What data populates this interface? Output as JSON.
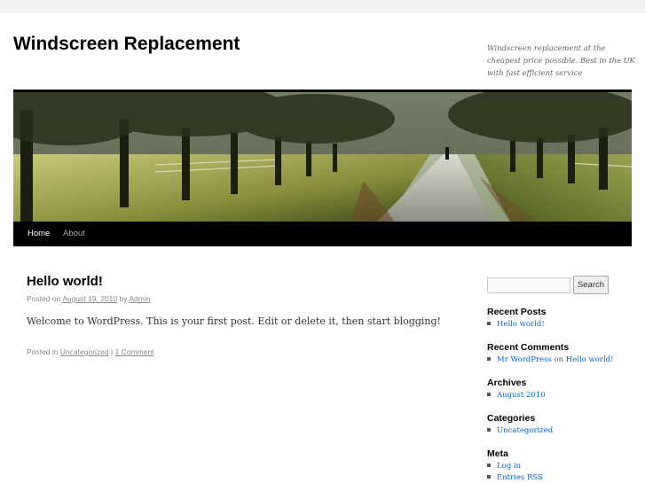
{
  "header": {
    "site_title": "Windscreen Replacement",
    "site_description": "Windscreen replacement at the cheapest price possible. Best in the UK with fast efficient service"
  },
  "nav": {
    "items": [
      {
        "label": "Home",
        "current": true
      },
      {
        "label": "About",
        "current": false
      }
    ]
  },
  "post": {
    "title": "Hello world!",
    "posted_on_prefix": "Posted on",
    "date": "August 19, 2010",
    "by": "by",
    "author": "Admin",
    "content": "Welcome to WordPress. This is your first post. Edit or delete it, then start blogging!",
    "posted_in_prefix": "Posted in",
    "category": "Uncategorized",
    "separator": "|",
    "comments": "1 Comment"
  },
  "sidebar": {
    "search_button": "Search",
    "search_value": "",
    "recent_posts_title": "Recent Posts",
    "recent_posts": [
      "Hello world!"
    ],
    "recent_comments_title": "Recent Comments",
    "recent_comment": {
      "author": "Mr WordPress",
      "on": "on",
      "post": "Hello world!"
    },
    "archives_title": "Archives",
    "archives": [
      "August 2010"
    ],
    "categories_title": "Categories",
    "categories": [
      "Uncategorized"
    ],
    "meta_title": "Meta",
    "meta": [
      "Log in",
      "Entries RSS"
    ]
  },
  "colors": {
    "page_background": "#f1f1f1",
    "nav_background": "#000000",
    "link_blue": "#0066cc"
  },
  "icons": {
    "list_bullet": "square-bullet-icon"
  }
}
